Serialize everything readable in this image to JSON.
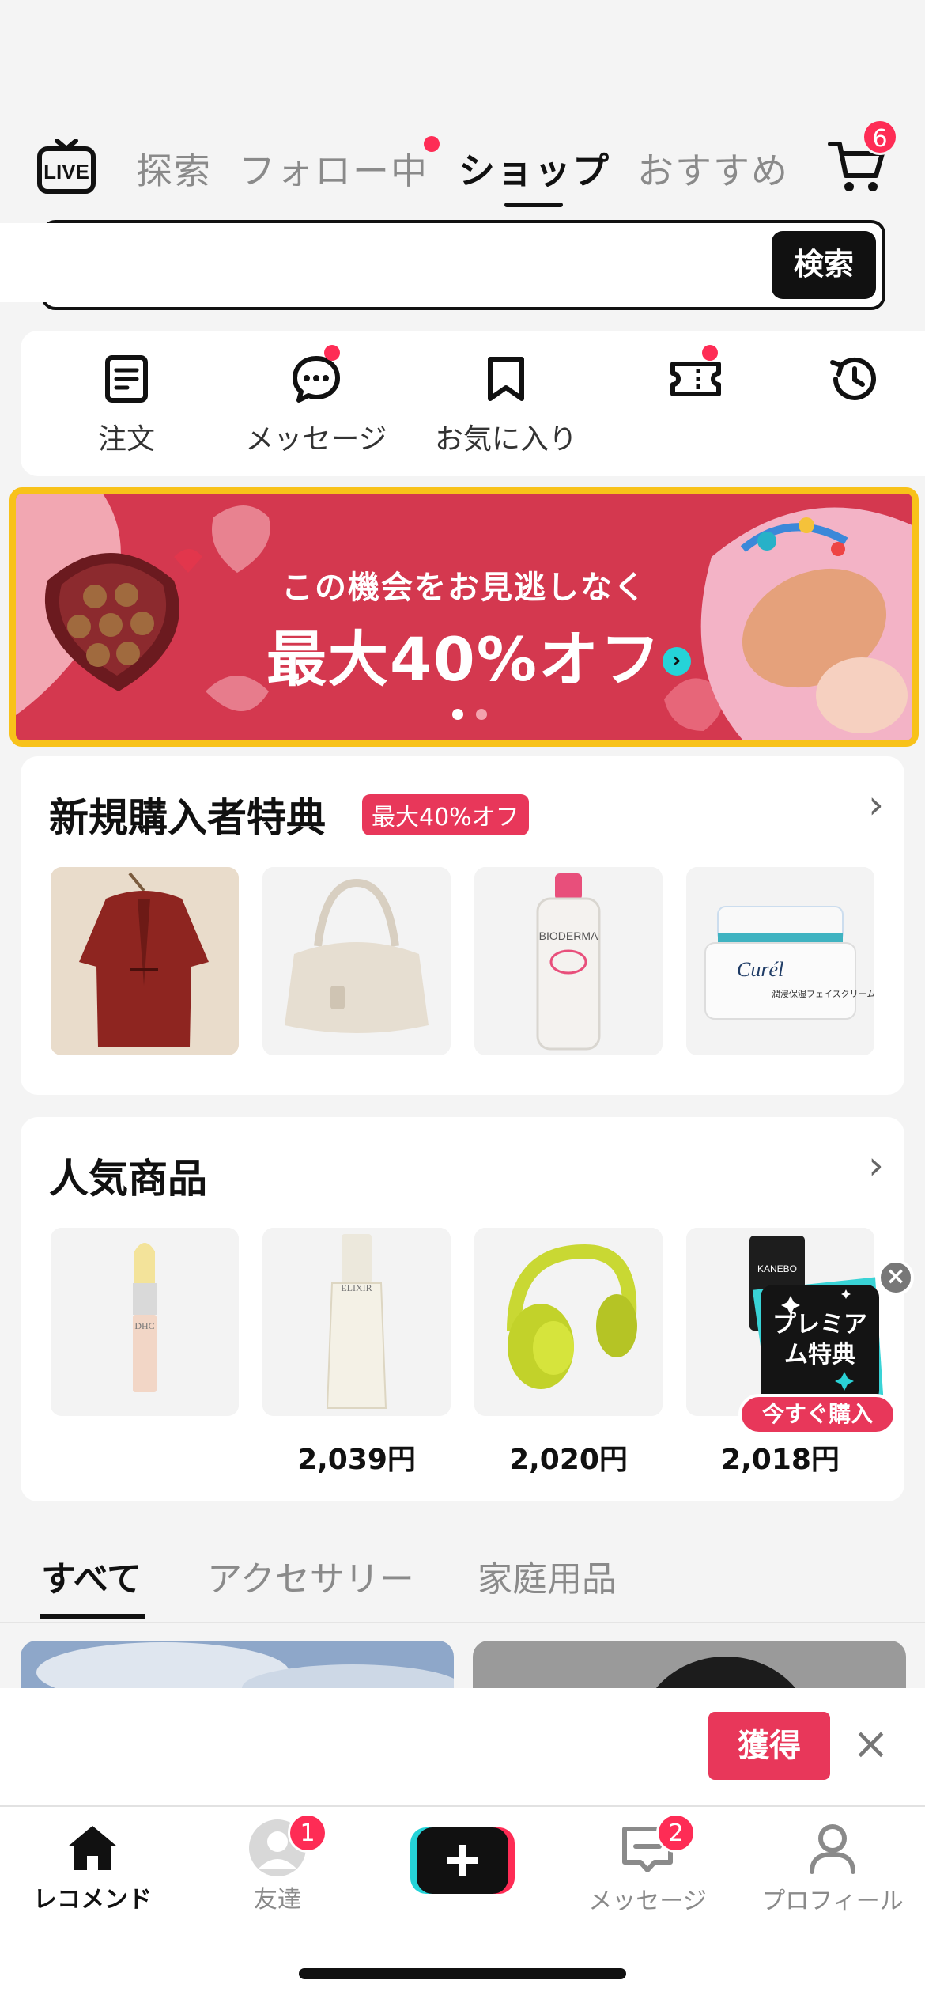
{
  "top_tabs": {
    "live_label": "LIVE",
    "tabs": [
      {
        "label": "探索"
      },
      {
        "label": "フォロー中"
      },
      {
        "label": "ショップ"
      },
      {
        "label": "おすすめ"
      }
    ],
    "cart_count": "6"
  },
  "search": {
    "placeholder": "",
    "button_label": "検索"
  },
  "quick_actions": [
    {
      "label": "注文",
      "icon": "order-document-icon"
    },
    {
      "label": "メッセージ",
      "icon": "chat-bubble-icon"
    },
    {
      "label": "お気に入り",
      "icon": "bookmark-icon"
    },
    {
      "label": "",
      "icon": "coupon-ticket-icon"
    },
    {
      "label": "",
      "icon": "history-clock-icon"
    }
  ],
  "banner": {
    "subtitle": "この機会をお見逃しなく",
    "headline": "最大40%オフ",
    "page_count": 2,
    "current_page": 1
  },
  "new_buyer": {
    "title": "新規購入者特典",
    "badge": "最大40%オフ",
    "products": [
      {
        "name": "red-cardigan"
      },
      {
        "name": "beige-handbag"
      },
      {
        "name": "bioderma-cleansing-water",
        "brand_text": "BIODERMA"
      },
      {
        "name": "curel-moisture-cream",
        "brand_text": "Curél",
        "product_text": "潤浸保湿フェイスクリーム"
      }
    ]
  },
  "popular": {
    "title": "人気商品",
    "products": [
      {
        "name": "dhc-lip-cream",
        "brand_text": "DHC",
        "price": ""
      },
      {
        "name": "elixir-lotion",
        "brand_text": "ELIXIR",
        "price": "2,039円"
      },
      {
        "name": "yellow-headphones",
        "price": "2,020円"
      },
      {
        "name": "kanebo-cleanser",
        "brand_text": "KANEBO",
        "price": "2,018円"
      }
    ]
  },
  "premium_popup": {
    "title": "プレミアム特典",
    "cta": "今すぐ購入"
  },
  "category_tabs": [
    {
      "label": "すべて"
    },
    {
      "label": "アクセサリー"
    },
    {
      "label": "家庭用品"
    }
  ],
  "claim_bar": {
    "button_label": "獲得",
    "close": "×"
  },
  "bottom_nav": [
    {
      "label": "レコメンド",
      "icon": "home-icon",
      "badge": ""
    },
    {
      "label": "友達",
      "icon": "avatar-icon",
      "badge": "1"
    },
    {
      "label": "",
      "icon": "create-plus-icon",
      "badge": ""
    },
    {
      "label": "メッセージ",
      "icon": "inbox-icon",
      "badge": "2"
    },
    {
      "label": "プロフィール",
      "icon": "profile-icon",
      "badge": ""
    }
  ],
  "colors": {
    "accent_red": "#fe2c55",
    "banner_red": "#d4384f",
    "banner_border": "#f8c21a",
    "badge_red": "#e8375a"
  }
}
